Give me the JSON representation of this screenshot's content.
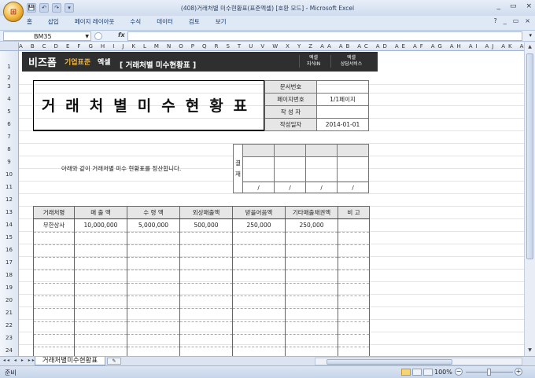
{
  "window": {
    "title": "(408)거래처별 미수현황표(표준엑셀) [호환 모드] - Microsoft Excel",
    "controls": [
      "_",
      "▭",
      "×"
    ]
  },
  "qat": [
    "💾",
    "↶",
    "↷",
    "▾"
  ],
  "ribbon": {
    "tabs": [
      "홈",
      "삽입",
      "페이지 레이아웃",
      "수식",
      "데이터",
      "검토",
      "보기"
    ],
    "right": [
      "?",
      "_",
      "▭",
      "×"
    ]
  },
  "formula_bar": {
    "name_box": "BM35",
    "fx": "fx",
    "value": ""
  },
  "columns": "A B C D E F G H I J K L M N O P Q R S T U V W X Y Z AA AB AC AD AE AF AG AH AI AJ AK AL AM AN AO AP AQ AR AS AT AU AV",
  "rows": [
    "1",
    "2",
    "3",
    "4",
    "5",
    "6",
    "7",
    "8",
    "9",
    "10",
    "11",
    "12",
    "13",
    "14",
    "15",
    "16",
    "17",
    "18",
    "19",
    "20",
    "21",
    "22",
    "23",
    "24"
  ],
  "banner": {
    "logo": "비즈폼",
    "logo_sub1": "기업표준",
    "logo_sub2": "엑셀",
    "title": "[ 거래처별 미수현황표 ]",
    "btn1_line1": "엑셀",
    "btn1_line2": "지식IN",
    "btn2_line1": "엑셀",
    "btn2_line2": "상담서비스"
  },
  "doc": {
    "big_title": "거래처별미수현황표",
    "info": [
      {
        "label": "문서번호",
        "value": ""
      },
      {
        "label": "페이지번호",
        "value": "1/1페이지"
      },
      {
        "label": "작 성 자",
        "value": ""
      },
      {
        "label": "작성일자",
        "value": "2014-01-01"
      }
    ],
    "message": "아래와 같이 거래처별 미수 현황표를 정산합니다.",
    "approval_side": "결\n재",
    "approval_slash": [
      "/",
      "/",
      "/",
      "/"
    ]
  },
  "table": {
    "headers": [
      "거래처명",
      "매 출 액",
      "수 령 액",
      "외상매출액",
      "받을어음액",
      "기타매출채권액",
      "비 고"
    ],
    "rows": [
      [
        "무한상사",
        "10,000,000",
        "5,000,000",
        "500,000",
        "250,000",
        "250,000",
        ""
      ]
    ],
    "empty_rows": 10
  },
  "sheet_tabs": {
    "active": "거래처별미수현황표",
    "nav": "◂◂ ◂ ▸ ▸▸"
  },
  "status": {
    "ready": "준비",
    "zoom": "100%",
    "zoom_level": 0.5
  }
}
